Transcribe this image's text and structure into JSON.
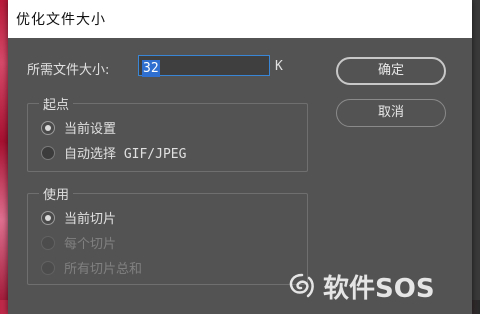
{
  "dialog": {
    "title": "优化文件大小",
    "size_label": "所需文件大小:",
    "size_value": "32",
    "size_unit": "K",
    "start_group": {
      "title": "起点",
      "options": [
        {
          "label": "当前设置",
          "checked": true,
          "disabled": false
        },
        {
          "label": "自动选择 GIF/JPEG",
          "checked": false,
          "disabled": false
        }
      ]
    },
    "use_group": {
      "title": "使用",
      "options": [
        {
          "label": "当前切片",
          "checked": true,
          "disabled": false
        },
        {
          "label": "每个切片",
          "checked": false,
          "disabled": true
        },
        {
          "label": "所有切片总和",
          "checked": false,
          "disabled": true
        }
      ]
    },
    "ok_label": "确定",
    "cancel_label": "取消"
  },
  "watermark": {
    "text": "软件SOS",
    "icon": "logo-swirl-icon"
  },
  "colors": {
    "dialog_bg": "#535353",
    "titlebar_bg": "#ffffff",
    "input_border": "#3a86d6",
    "selection_bg": "#2f6fd0"
  }
}
